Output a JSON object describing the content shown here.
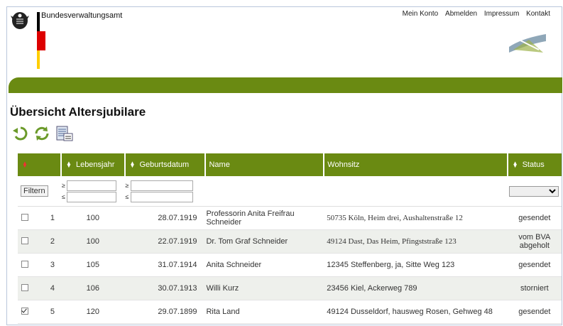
{
  "header": {
    "org_name": "Bundesverwaltungsamt",
    "nav": [
      "Mein Konto",
      "Abmelden",
      "Impressum",
      "Kontakt"
    ]
  },
  "page": {
    "title": "Übersicht Altersjubilare"
  },
  "toolbar": {
    "icons": [
      "back-icon",
      "refresh-icon",
      "report-icon"
    ]
  },
  "table": {
    "columns": [
      "",
      "Lebensjahr",
      "Geburtsdatum",
      "Name",
      "Wohnsitz",
      "Status"
    ],
    "filter": {
      "button_label": "Filtern",
      "ge_symbol": "≥",
      "le_symbol": "≤"
    },
    "rows": [
      {
        "checked": false,
        "nr": "1",
        "lebensjahr": "100",
        "geburtsdatum": "28.07.1919",
        "name": "Professorin Anita Freifrau Schneider",
        "wohnsitz": "50735 Köln, Heim drei, Aushaltenstraße 12",
        "status": "gesendet"
      },
      {
        "checked": false,
        "nr": "2",
        "lebensjahr": "100",
        "geburtsdatum": "22.07.1919",
        "name": "Dr. Tom Graf Schneider",
        "wohnsitz": "49124 Dast, Das Heim, Pfingststraße 123",
        "status": "vom BVA abgeholt"
      },
      {
        "checked": false,
        "nr": "3",
        "lebensjahr": "105",
        "geburtsdatum": "31.07.1914",
        "name": "Anita Schneider",
        "wohnsitz": "12345 Steffenberg, ja, Sitte Weg 123",
        "status": "gesendet"
      },
      {
        "checked": false,
        "nr": "4",
        "lebensjahr": "106",
        "geburtsdatum": "30.07.1913",
        "name": "Willi Kurz",
        "wohnsitz": "23456 Kiel, Ackerweg 789",
        "status": "storniert"
      },
      {
        "checked": true,
        "nr": "5",
        "lebensjahr": "120",
        "geburtsdatum": "29.07.1899",
        "name": "Rita Land",
        "wohnsitz": "49124 Dusseldorf, hausweg Rosen, Gehweg 48",
        "status": "gesendet"
      }
    ]
  },
  "colors": {
    "accent_green": "#6a8a12",
    "flag_black": "#000000",
    "flag_red": "#dd0000",
    "flag_gold": "#ffce00"
  }
}
